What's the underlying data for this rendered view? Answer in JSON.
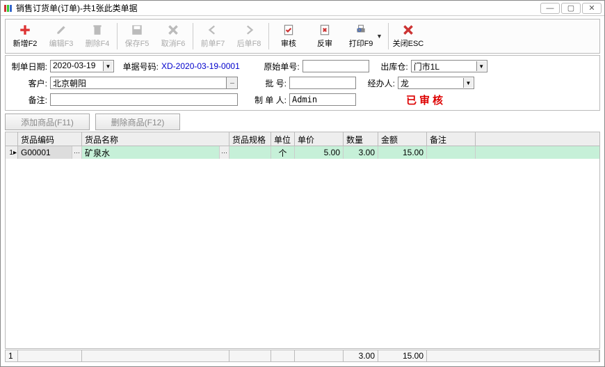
{
  "title": "销售订货单(订单)-共1张此类单据",
  "toolbar": {
    "new": "新增F2",
    "edit": "编辑F3",
    "delete": "删除F4",
    "save": "保存F5",
    "cancel": "取消F6",
    "prev": "前单F7",
    "next": "后单F8",
    "audit": "审核",
    "unaudit": "反审",
    "print": "打印F9",
    "close": "关闭ESC"
  },
  "form": {
    "dateLabel": "制单日期:",
    "date": "2020-03-19",
    "billNoLabel": "单据号码:",
    "billNo": "XD-2020-03-19-0001",
    "origNoLabel": "原始单号:",
    "origNo": "",
    "warehouseLabel": "出库仓:",
    "warehouse": "门市1L",
    "customerLabel": "客户:",
    "customer": "北京朝阳",
    "batchLabel": "批    号:",
    "batch": "",
    "handlerLabel": "经办人:",
    "handler": "龙",
    "remarkLabel": "备注:",
    "remark": "",
    "makerLabel": "制 单 人:",
    "maker": "Admin",
    "status": "已审核"
  },
  "actions": {
    "add": "添加商品(F11)",
    "del": "删除商品(F12)"
  },
  "grid": {
    "headers": {
      "code": "货品编码",
      "name": "货品名称",
      "spec": "货品规格",
      "unit": "单位",
      "price": "单价",
      "qty": "数量",
      "amount": "金额",
      "remark": "备注"
    },
    "row": {
      "idx": "1",
      "code": "G00001",
      "name": "矿泉水",
      "spec": "",
      "unit": "个",
      "price": "5.00",
      "qty": "3.00",
      "amount": "15.00",
      "remark": ""
    }
  },
  "footer": {
    "idx": "1",
    "qty": "3.00",
    "amount": "15.00"
  }
}
